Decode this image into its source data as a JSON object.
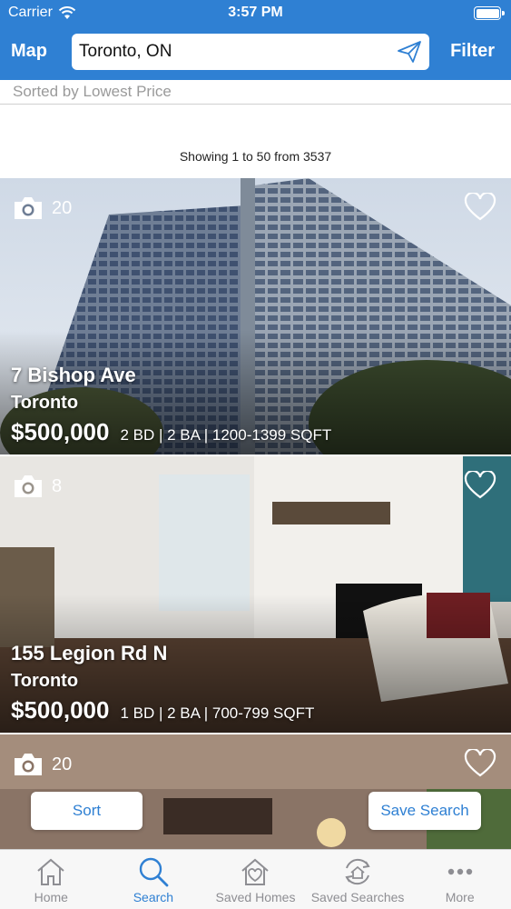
{
  "status_bar": {
    "carrier": "Carrier",
    "time": "3:57 PM"
  },
  "nav": {
    "map_label": "Map",
    "filter_label": "Filter",
    "search_value": "Toronto, ON"
  },
  "sort_info": "Sorted by Lowest Price",
  "showing": "Showing 1 to 50 from 3537",
  "listings": [
    {
      "photo_count": "20",
      "address": "7 Bishop Ave",
      "city": "Toronto",
      "price": "$500,000",
      "details": "2 BD | 2 BA | 1200-1399 SQFT"
    },
    {
      "photo_count": "8",
      "address": "155 Legion Rd N",
      "city": "Toronto",
      "price": "$500,000",
      "details": "1 BD | 2 BA | 700-799 SQFT"
    },
    {
      "photo_count": "20"
    }
  ],
  "buttons": {
    "sort": "Sort",
    "save_search": "Save Search"
  },
  "tabs": [
    {
      "label": "Home",
      "icon": "home-icon"
    },
    {
      "label": "Search",
      "icon": "search-icon"
    },
    {
      "label": "Saved Homes",
      "icon": "saved-homes-icon"
    },
    {
      "label": "Saved Searches",
      "icon": "saved-searches-icon"
    },
    {
      "label": "More",
      "icon": "more-icon"
    }
  ],
  "colors": {
    "accent": "#2f80d3",
    "tab_inactive": "#8e8e93"
  }
}
